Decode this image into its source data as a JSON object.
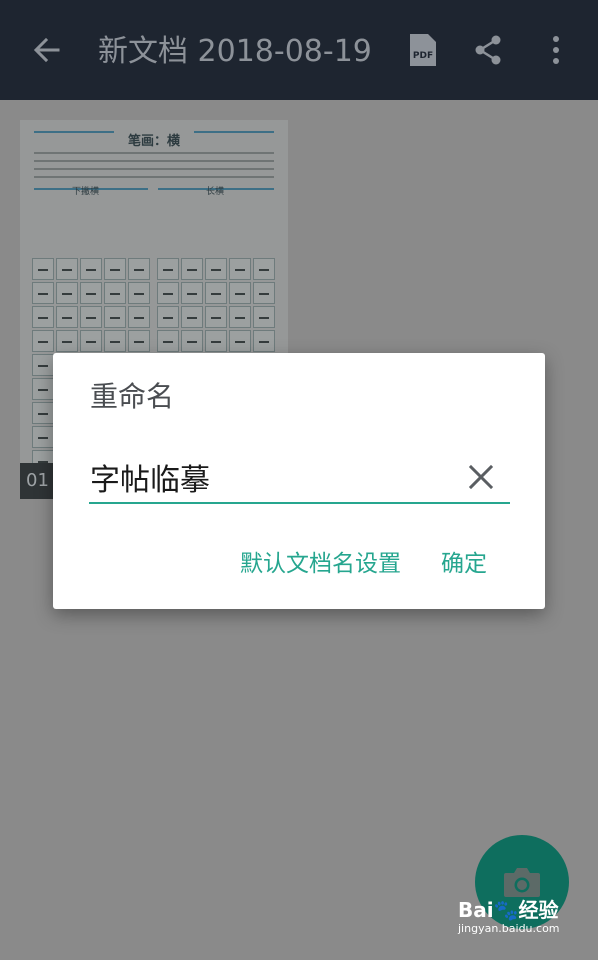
{
  "toolbar": {
    "title": "新文档 2018-08-19",
    "pdf_label": "PDF"
  },
  "document": {
    "page_badge": "01",
    "thumbnail_heading": "笔画：横",
    "left_section": "下撇横",
    "right_section": "长横"
  },
  "dialog": {
    "title": "重命名",
    "input_value": "字帖临摹",
    "default_name_button": "默认文档名设置",
    "confirm_button": "确定"
  },
  "watermark": {
    "logo": "Bai🐾经验",
    "url": "jingyan.baidu.com"
  },
  "colors": {
    "accent": "#26a68f",
    "toolbar": "#1e2530",
    "scrim": "#8a8a8a"
  }
}
